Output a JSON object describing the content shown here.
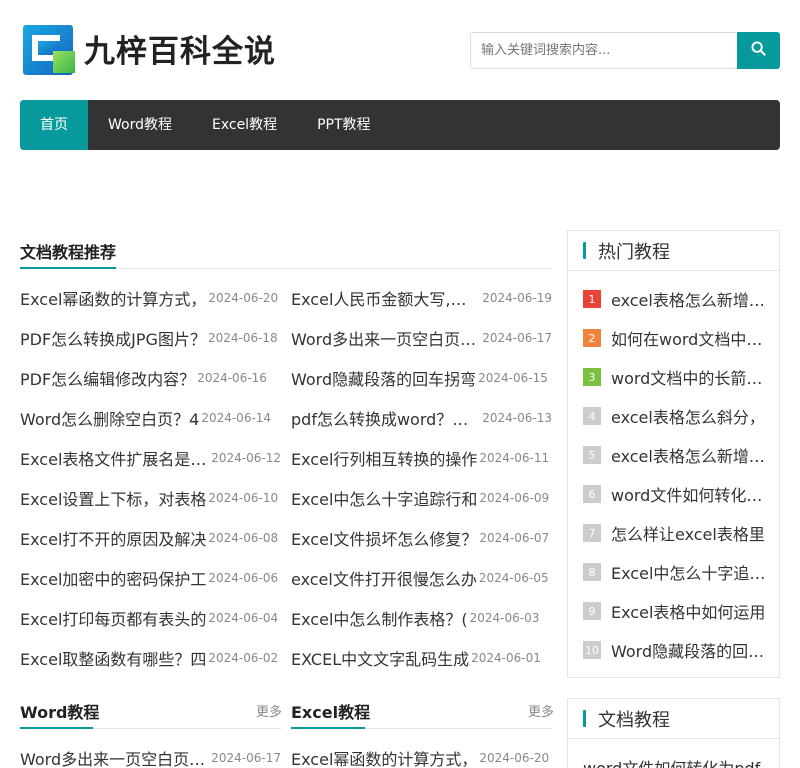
{
  "site": {
    "name": "九梓百科全说"
  },
  "search": {
    "placeholder": "输入关键词搜索内容..."
  },
  "nav": [
    {
      "label": "首页",
      "active": true
    },
    {
      "label": "Word教程",
      "active": false
    },
    {
      "label": "Excel教程",
      "active": false
    },
    {
      "label": "PPT教程",
      "active": false
    }
  ],
  "featured": {
    "title": "文档教程推荐",
    "left": [
      {
        "title": "Excel幂函数的计算方式，",
        "date": "2024-06-20"
      },
      {
        "title": "PDF怎么转换成JPG图片？",
        "date": "2024-06-18"
      },
      {
        "title": "PDF怎么编辑修改内容？",
        "date": "2024-06-16"
      },
      {
        "title": "Word怎么删除空白页？4",
        "date": "2024-06-14"
      },
      {
        "title": "Excel表格文件扩展名是什么",
        "date": "2024-06-12"
      },
      {
        "title": "Excel设置上下标，对表格",
        "date": "2024-06-10"
      },
      {
        "title": "Excel打不开的原因及解决",
        "date": "2024-06-08"
      },
      {
        "title": "Excel加密中的密码保护工",
        "date": "2024-06-06"
      },
      {
        "title": "Excel打印每页都有表头的",
        "date": "2024-06-04"
      },
      {
        "title": "Excel取整函数有哪些？四",
        "date": "2024-06-02"
      }
    ],
    "right": [
      {
        "title": "Excel人民币金额大写,怎么",
        "date": "2024-06-19"
      },
      {
        "title": "Word多出来一页空白页删除",
        "date": "2024-06-17"
      },
      {
        "title": "Word隐藏段落的回车拐弯",
        "date": "2024-06-15"
      },
      {
        "title": "pdf怎么转换成word？试试",
        "date": "2024-06-13"
      },
      {
        "title": "Excel行列相互转换的操作",
        "date": "2024-06-11"
      },
      {
        "title": "Excel中怎么十字追踪行和",
        "date": "2024-06-09"
      },
      {
        "title": "Excel文件损坏怎么修复？",
        "date": "2024-06-07"
      },
      {
        "title": "excel文件打开很慢怎么办",
        "date": "2024-06-05"
      },
      {
        "title": "Excel中怎么制作表格？(",
        "date": "2024-06-03"
      },
      {
        "title": "EXCEL中文文字乱码生成",
        "date": "2024-06-01"
      }
    ]
  },
  "word_section": {
    "title": "Word教程",
    "more": "更多",
    "items": [
      {
        "title": "Word多出来一页空白页删除",
        "date": "2024-06-17"
      }
    ]
  },
  "excel_section": {
    "title": "Excel教程",
    "more": "更多",
    "items": [
      {
        "title": "Excel幂函数的计算方式，",
        "date": "2024-06-20"
      }
    ]
  },
  "hot": {
    "title": "热门教程",
    "items": [
      {
        "rank": "1",
        "title": "excel表格怎么新增一行",
        "color": "#e84335"
      },
      {
        "rank": "2",
        "title": "如何在word文档中加入",
        "color": "#f0843a"
      },
      {
        "rank": "3",
        "title": "word文档中的长箭头怎么",
        "color": "#7cc042"
      },
      {
        "rank": "4",
        "title": "excel表格怎么斜分，",
        "color": "#cccccc"
      },
      {
        "rank": "5",
        "title": "excel表格怎么新增一行",
        "color": "#cccccc"
      },
      {
        "rank": "6",
        "title": "word文件如何转化为pdf",
        "color": "#cccccc"
      },
      {
        "rank": "7",
        "title": "怎么样让excel表格里",
        "color": "#cccccc"
      },
      {
        "rank": "8",
        "title": "Excel中怎么十字追踪行",
        "color": "#cccccc"
      },
      {
        "rank": "9",
        "title": "Excel表格中如何运用",
        "color": "#cccccc"
      },
      {
        "rank": "10",
        "title": "Word隐藏段落的回车拐弯",
        "color": "#cccccc"
      }
    ]
  },
  "doc_box": {
    "title": "文档教程",
    "items": [
      {
        "title": "word文件如何转化为pdf"
      }
    ]
  },
  "colors": {
    "accent": "#07999b",
    "nav_bg": "#333333"
  }
}
